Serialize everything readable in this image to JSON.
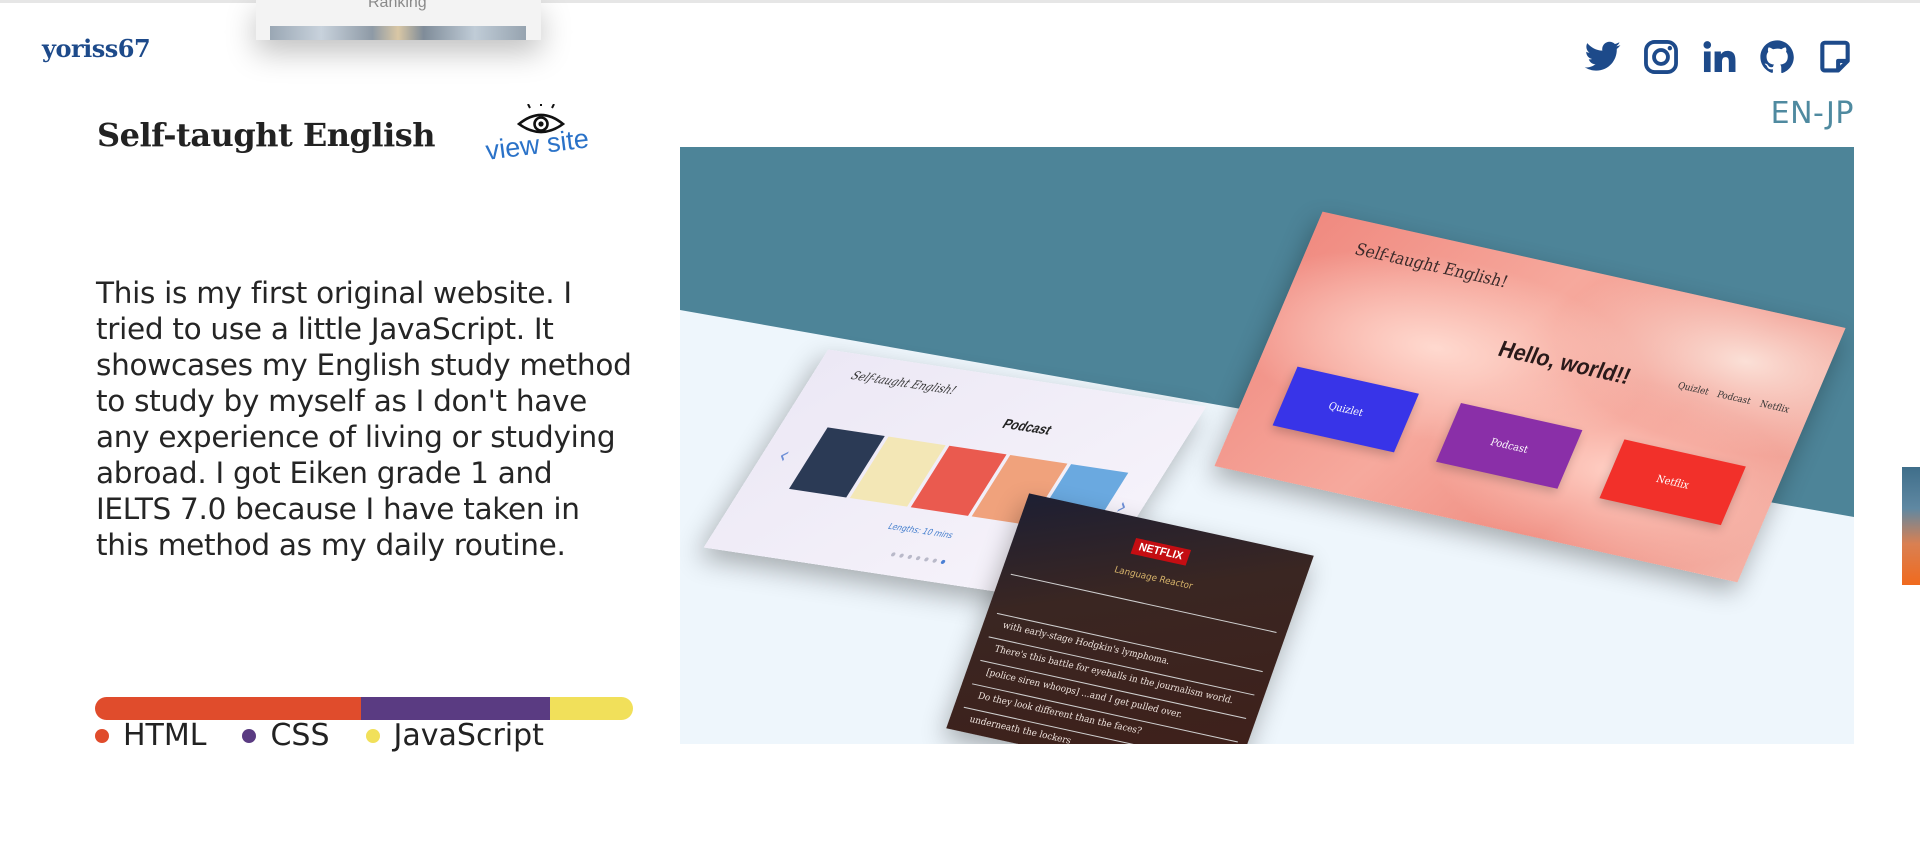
{
  "floating_card": {
    "label": "Ranking"
  },
  "header": {
    "logo": "yoriss67",
    "socials": [
      {
        "name": "twitter",
        "icon": "twitter-icon"
      },
      {
        "name": "instagram",
        "icon": "instagram-icon"
      },
      {
        "name": "linkedin",
        "icon": "linkedin-icon"
      },
      {
        "name": "github",
        "icon": "github-icon"
      },
      {
        "name": "note",
        "icon": "note-icon"
      }
    ],
    "language_toggle": "EN-JP"
  },
  "project": {
    "title": "Self-taught English",
    "view_site_label": "view site",
    "description": "This is my first original website. I tried to use a little JavaScript. It showcases my English study method to study by myself as I don't have any experience of living or studying abroad. I got Eiken grade 1 and IELTS 7.0 because I have taken in this method as my daily routine.",
    "languages": [
      {
        "name": "HTML",
        "share": 0.494,
        "color": "#e04c2c"
      },
      {
        "name": "CSS",
        "share": 0.352,
        "color": "#5a3b82"
      },
      {
        "name": "JavaScript",
        "share": 0.154,
        "color": "#f1e05a"
      }
    ]
  },
  "preview": {
    "colors": {
      "top_band": "#4d8498",
      "bottom": "#eef6fc"
    },
    "podcast_mock": {
      "brand": "Self-taught English!",
      "title": "Podcast",
      "caption": "Lengths: 10 mins"
    },
    "netflix_mock": {
      "logo": "NETFLIX",
      "subtitle": "Language Reactor",
      "lines": [
        "with early-stage Hodgkin's lymphoma.",
        "There's this battle for eyeballs in the journalism world.",
        "[police siren whoops] ...and I get pulled over.",
        "Do they look different than the faces?",
        "underneath the lockers"
      ]
    },
    "hello_mock": {
      "brand": "Self-taught English!",
      "heading": "Hello, world!!",
      "nav": [
        "Quizlet",
        "Podcast",
        "Netflix"
      ],
      "buttons": [
        {
          "label": "Quizlet",
          "color": "#3834e8"
        },
        {
          "label": "Podcast",
          "color": "#8a2fa8"
        },
        {
          "label": "Netflix",
          "color": "#f2302a"
        }
      ]
    }
  }
}
